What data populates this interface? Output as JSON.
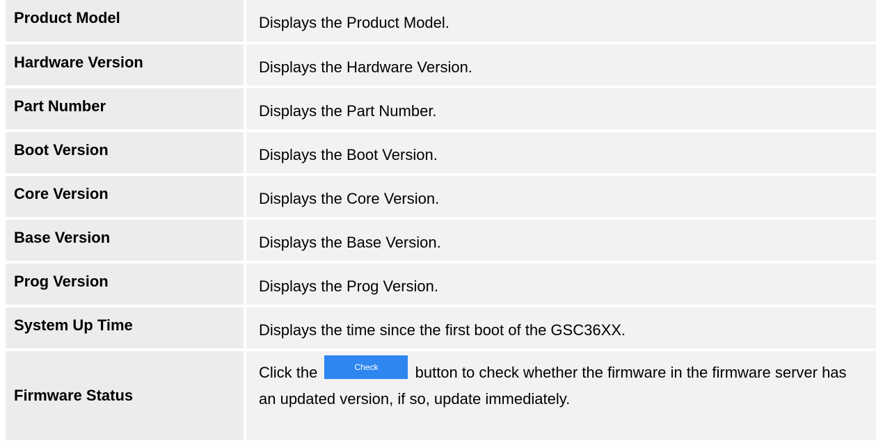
{
  "rows": [
    {
      "label": "Product Model",
      "description": "Displays the Product Model."
    },
    {
      "label": "Hardware Version",
      "description": "Displays the Hardware Version."
    },
    {
      "label": "Part Number",
      "description": "Displays the Part Number."
    },
    {
      "label": "Boot Version",
      "description": "Displays the Boot Version."
    },
    {
      "label": "Core Version",
      "description": "Displays the Core Version."
    },
    {
      "label": "Base Version",
      "description": "Displays the Base Version."
    },
    {
      "label": "Prog Version",
      "description": "Displays the Prog Version."
    },
    {
      "label": "System Up Time",
      "description": "Displays the time since the first boot of the GSC36XX."
    }
  ],
  "firmware": {
    "label": "Firmware Status",
    "text_before": "Click the",
    "button_label": "Check",
    "text_after": "button to check whether the firmware in the firmware server has an updated version, if so, update immediately.",
    "button_color": "#2e86f0"
  }
}
